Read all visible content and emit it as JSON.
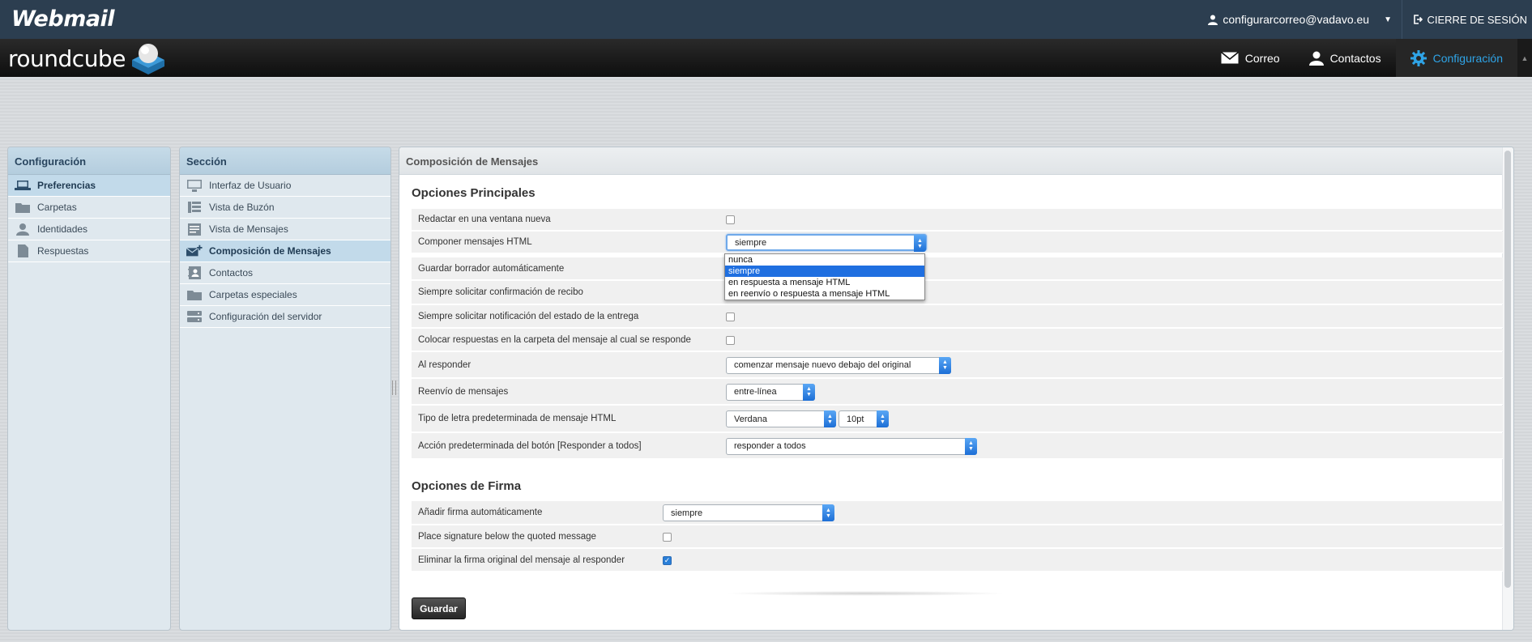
{
  "topbar": {
    "brand": "Webmail",
    "user_email": "configurarcorreo@vadavo.eu",
    "logout_label": "CIERRE DE SESIÓN"
  },
  "header": {
    "logo_text": "roundcube",
    "nav": [
      {
        "label": "Correo",
        "icon": "envelope-icon"
      },
      {
        "label": "Contactos",
        "icon": "person-icon"
      },
      {
        "label": "Configuración",
        "icon": "gear-icon",
        "active": true
      }
    ]
  },
  "settings_panel": {
    "title": "Configuración",
    "items": [
      {
        "label": "Preferencias",
        "icon": "laptop-icon",
        "selected": true
      },
      {
        "label": "Carpetas",
        "icon": "folder-icon"
      },
      {
        "label": "Identidades",
        "icon": "identity-icon"
      },
      {
        "label": "Respuestas",
        "icon": "document-icon"
      }
    ]
  },
  "section_panel": {
    "title": "Sección",
    "items": [
      {
        "label": "Interfaz de Usuario",
        "icon": "monitor-icon"
      },
      {
        "label": "Vista de Buzón",
        "icon": "mailbox-view-icon"
      },
      {
        "label": "Vista de Mensajes",
        "icon": "message-view-icon"
      },
      {
        "label": "Composición de Mensajes",
        "icon": "compose-icon",
        "selected": true
      },
      {
        "label": "Contactos",
        "icon": "address-book-icon"
      },
      {
        "label": "Carpetas especiales",
        "icon": "folder-icon"
      },
      {
        "label": "Configuración del servidor",
        "icon": "server-icon"
      }
    ]
  },
  "main": {
    "title": "Composición de Mensajes",
    "main_options_title": "Opciones Principales",
    "main_options": [
      {
        "label": "Redactar en una ventana nueva",
        "type": "checkbox",
        "checked": false
      },
      {
        "label": "Componer mensajes HTML",
        "type": "select",
        "value": "siempre"
      },
      {
        "label": "Guardar borrador automáticamente",
        "type": "hidden"
      },
      {
        "label": "Siempre solicitar confirmación de recibo",
        "type": "hidden"
      },
      {
        "label": "Siempre solicitar notificación del estado de la entrega",
        "type": "checkbox",
        "checked": false
      },
      {
        "label": "Colocar respuestas en la carpeta del mensaje al cual se responde",
        "type": "checkbox",
        "checked": false
      },
      {
        "label": "Al responder",
        "type": "select",
        "value": "comenzar mensaje nuevo debajo del original"
      },
      {
        "label": "Reenvío de mensajes",
        "type": "select",
        "value": "entre-línea"
      },
      {
        "label": "Tipo de letra predeterminada de mensaje HTML",
        "type": "select2",
        "value": "Verdana",
        "value2": "10pt"
      },
      {
        "label": "Acción predeterminada del botón [Responder a todos]",
        "type": "select",
        "value": "responder a todos"
      }
    ],
    "html_dropdown_options": [
      "nunca",
      "siempre",
      "en respuesta a mensaje HTML",
      "en reenvío o respuesta a mensaje HTML"
    ],
    "html_dropdown_selected": "siempre",
    "signature_title": "Opciones de Firma",
    "signature_options": [
      {
        "label": "Añadir firma automáticamente",
        "type": "select",
        "value": "siempre"
      },
      {
        "label": "Place signature below the quoted message",
        "type": "checkbox",
        "checked": false
      },
      {
        "label": "Eliminar la firma original del mensaje al responder",
        "type": "checkbox",
        "checked": true
      }
    ],
    "save_label": "Guardar"
  },
  "colors": {
    "topbar": "#2c3e50",
    "accent": "#2fa4e7",
    "panel_head": "#b4cdde",
    "selected_row": "#c2daea"
  }
}
